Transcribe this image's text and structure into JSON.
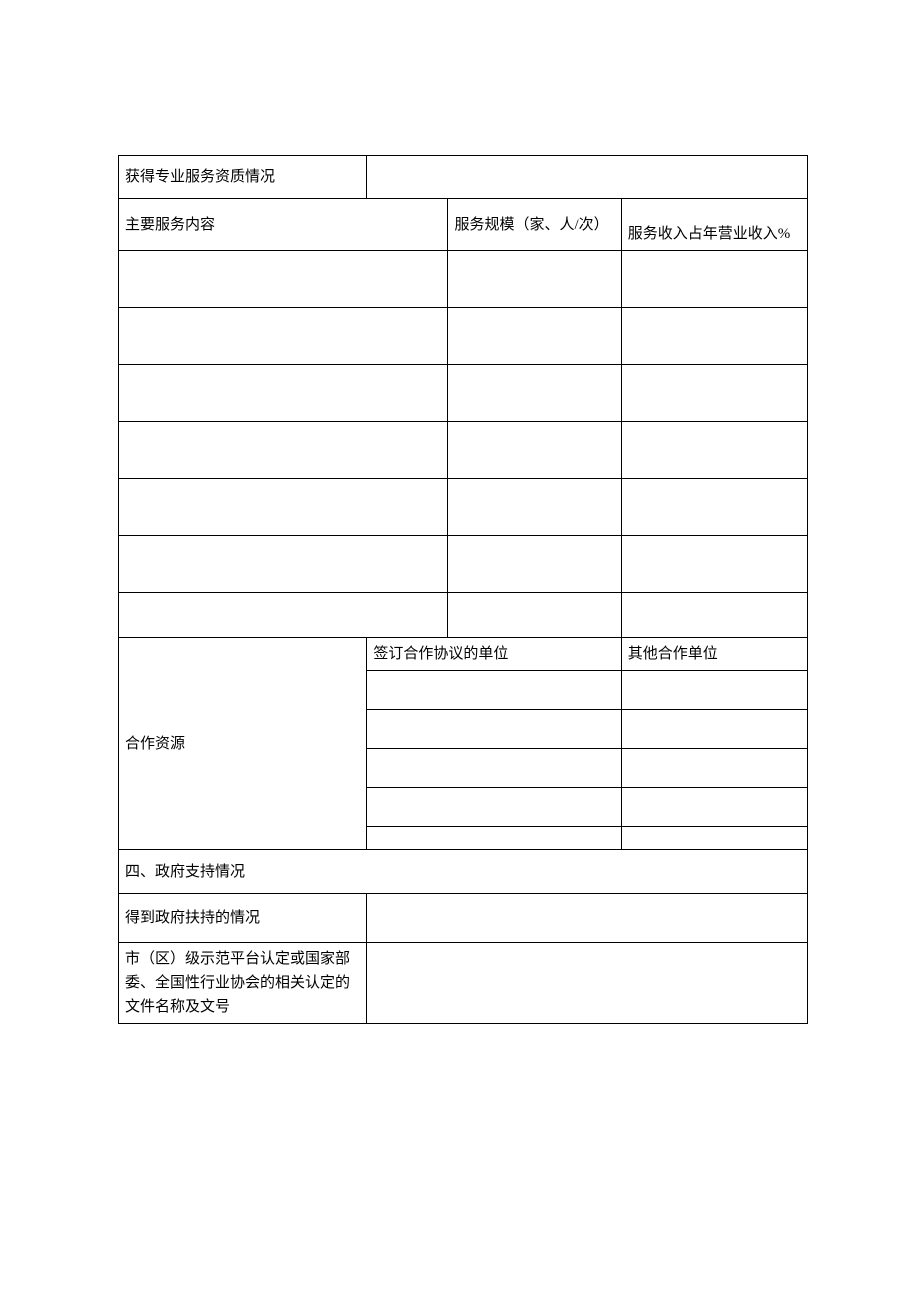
{
  "qualification": {
    "label": "获得专业服务资质情况",
    "value": ""
  },
  "service_header": {
    "main": "主要服务内容",
    "scale": "服务规模（家、人/次）",
    "rev_pct": "服务收入占年营业收入%"
  },
  "services": [
    {
      "content": "",
      "scale": "",
      "rev_pct": ""
    },
    {
      "content": "",
      "scale": "",
      "rev_pct": ""
    },
    {
      "content": "",
      "scale": "",
      "rev_pct": ""
    },
    {
      "content": "",
      "scale": "",
      "rev_pct": ""
    },
    {
      "content": "",
      "scale": "",
      "rev_pct": ""
    },
    {
      "content": "",
      "scale": "",
      "rev_pct": ""
    },
    {
      "content": "",
      "scale": "",
      "rev_pct": ""
    }
  ],
  "cooperation": {
    "label": "合作资源",
    "signed_label": "签订合作协议的单位",
    "other_label": "其他合作单位",
    "rows": [
      {
        "signed": "",
        "other": ""
      },
      {
        "signed": "",
        "other": ""
      },
      {
        "signed": "",
        "other": ""
      },
      {
        "signed": "",
        "other": ""
      },
      {
        "signed": "",
        "other": ""
      }
    ]
  },
  "section4": {
    "title": "四、政府支持情况"
  },
  "gov_support": {
    "label": "得到政府扶持的情况",
    "value": ""
  },
  "cert_doc": {
    "label": "市（区）级示范平台认定或国家部委、全国性行业协会的相关认定的文件名称及文号",
    "value": ""
  }
}
